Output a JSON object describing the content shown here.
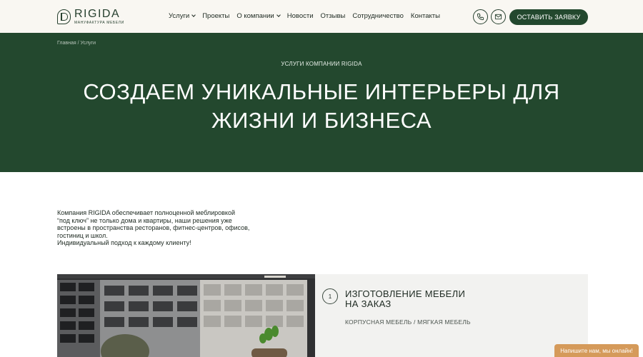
{
  "header": {
    "logo_name": "RIGIDA",
    "logo_sub": "МАНУФАКТУРА МЕБЕЛИ",
    "nav": [
      {
        "label": "Услуги",
        "dropdown": true
      },
      {
        "label": "Проекты",
        "dropdown": false
      },
      {
        "label": "О компании",
        "dropdown": true
      },
      {
        "label": "Новости",
        "dropdown": false
      },
      {
        "label": "Отзывы",
        "dropdown": false
      },
      {
        "label": "Сотрудничество",
        "dropdown": false
      },
      {
        "label": "Контакты",
        "dropdown": false
      }
    ],
    "phone_icon": "phone-icon",
    "mail_icon": "mail-icon",
    "cta_label": "ОСТАВИТЬ ЗАЯВКУ"
  },
  "hero": {
    "breadcrumb": "Главная / Услуги",
    "eyebrow": "УСЛУГИ КОМПАНИИ RIGIDA",
    "title_line1": "СОЗДАЕМ УНИКАЛЬНЫЕ ИНТЕРЬЕРЫ ДЛЯ",
    "title_line2": "ЖИЗНИ И БИЗНЕСА",
    "background_color": "#23482e"
  },
  "intro": {
    "line1": "Компания RIGIDA обеспечивает полноценной меблировкой",
    "line2": "“под ключ” не только дома и квартиры, наши решения уже",
    "line3": "встроены в пространства ресторанов, фитнес-центров, офисов,",
    "line4": "гостиниц и школ.",
    "line5": "Индивидуальный подход к каждому клиенту!"
  },
  "service": {
    "number": "1",
    "title_line1": "ИЗГОТОВЛЕНИЕ МЕБЕЛИ",
    "title_line2": "НА ЗАКАЗ",
    "subtitle": "КОРПУСНАЯ МЕБЕЛЬ / МЯГКАЯ МЕБЕЛЬ"
  },
  "chat": {
    "label": "Напишите нам, мы онлайн!",
    "color": "#d59a5a"
  },
  "colors": {
    "brand_green": "#23482e",
    "header_bg": "#f9f7f2"
  }
}
